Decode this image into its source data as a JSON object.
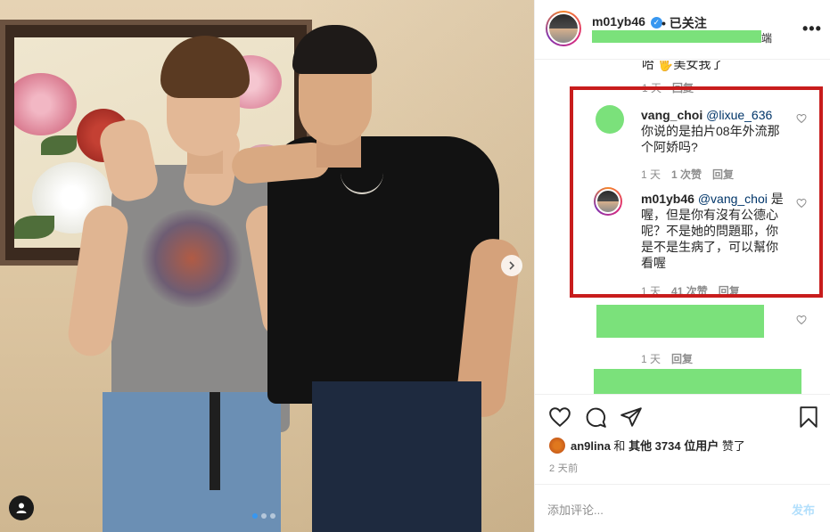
{
  "post": {
    "carousel": {
      "slide_count": 3,
      "active_index": 0
    }
  },
  "header": {
    "username": "m01yb46",
    "verified_glyph": "✓",
    "follow_status": "• 已关注",
    "location_tail": "端",
    "more": "•••"
  },
  "comments": {
    "cutoff_text": "哈 🖐美女我了 ⁀⁀⁀⁀",
    "cutoff_meta": {
      "time": "1 天",
      "reply": "回复"
    },
    "items": [
      {
        "username": "vang_choi",
        "mention": "@lixue_636",
        "text": " 你说的是拍片08年外流那个阿娇吗?",
        "time": "1 天",
        "likes": "1 次赞",
        "reply": "回复"
      },
      {
        "username": "m01yb46",
        "mention": "@vang_choi",
        "text": " 是喔，但是你有沒有公德心呢？不是她的問題耶，你是不是生病了，可以幫你看喔",
        "time": "1 天",
        "likes": "41 次赞",
        "reply": "回复"
      }
    ],
    "redacted_meta": {
      "time": "1 天",
      "reply": "回复"
    }
  },
  "likes_line": {
    "user": "an9lina",
    "connector": "和",
    "others": "其他 3734 位用户",
    "suffix": "赞了"
  },
  "time_ago": "2 天前",
  "composer": {
    "placeholder": "添加评论...",
    "post_label": "发布"
  },
  "colors": {
    "redaction_green": "#7be17b",
    "highlight_red": "#c81c1c",
    "link_blue": "#003569",
    "verified_blue": "#3897f0"
  }
}
